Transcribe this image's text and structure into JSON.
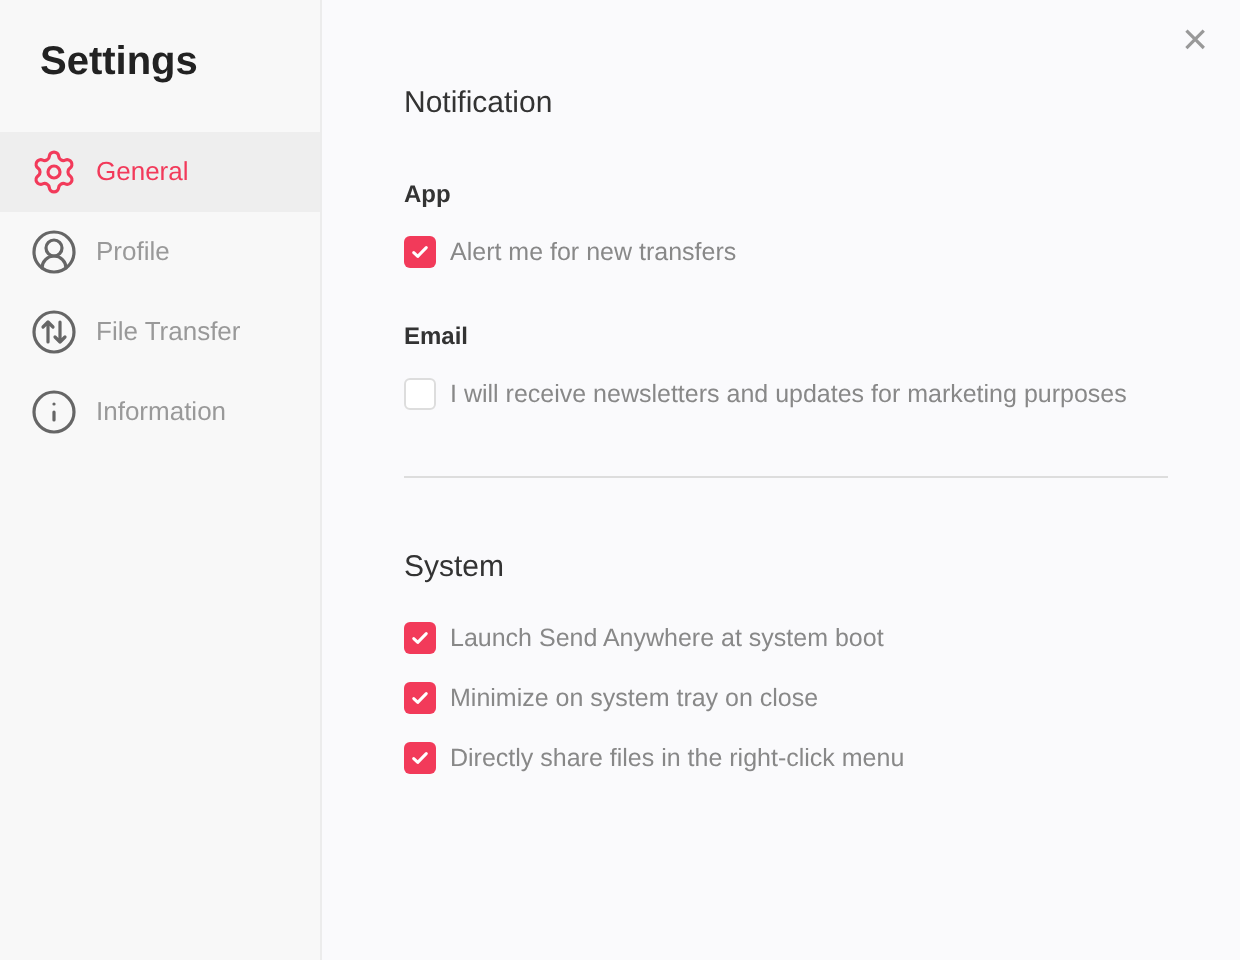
{
  "sidebar": {
    "title": "Settings",
    "items": [
      {
        "label": "General",
        "kind": "gear",
        "selected": true
      },
      {
        "label": "Profile",
        "kind": "user",
        "selected": false
      },
      {
        "label": "File Transfer",
        "kind": "transfer",
        "selected": false
      },
      {
        "label": "Information",
        "kind": "info",
        "selected": false
      }
    ]
  },
  "close": "×",
  "sections": [
    {
      "title": "Notification",
      "groups": [
        {
          "label": "App",
          "options": [
            {
              "label": "Alert me for new transfers",
              "checked": true
            }
          ]
        },
        {
          "label": "Email",
          "options": [
            {
              "label": "I will receive newsletters and updates for marketing purposes",
              "checked": false
            }
          ]
        }
      ]
    },
    {
      "title": "System",
      "groups": [
        {
          "options": [
            {
              "label": "Launch Send Anywhere at system boot",
              "checked": true
            },
            {
              "label": "Minimize on system tray on close",
              "checked": true
            },
            {
              "label": "Directly share files in the right-click menu",
              "checked": true
            }
          ]
        }
      ]
    }
  ]
}
